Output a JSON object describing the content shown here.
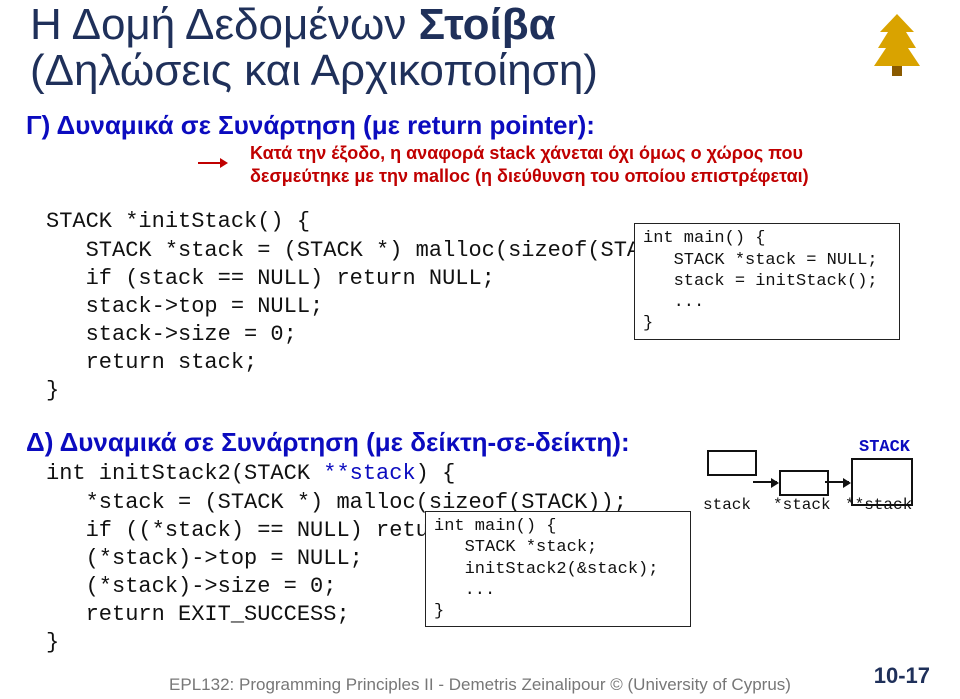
{
  "title": {
    "line1_a": "Η Δομή Δεδομένων ",
    "line1_b": "Στοίβα",
    "line2": "(Δηλώσεις και Αρχικοποίηση)"
  },
  "sectionC": {
    "heading": "Γ) Δυναμικά σε Συνάρτηση (με return pointer):",
    "note1": "Κατά την έξοδο, η αναφορά stack χάνεται όχι όμως ο χώρος που",
    "note2": "δεσμεύτηκε με την malloc (η διεύθυνση του οποίου επιστρέφεται)",
    "code": "STACK *initStack() {\n   STACK *stack = (STACK *) malloc(sizeof(STACK));\n   if (stack == NULL) return NULL;\n   stack->top = NULL;\n   stack->size = 0;\n   return stack;\n}",
    "usage": "int main() {\n   STACK *stack = NULL;\n   stack = initStack();\n   ...\n}"
  },
  "sectionD": {
    "heading": "Δ) Δυναμικά σε Συνάρτηση (με δείκτη-σε-δείκτη):",
    "code_l1": "int initStack2(STACK ",
    "code_l1b": "**stack",
    "code_l1c": ") {",
    "code_l2": "   *stack = (STACK *) malloc(sizeof(STACK));",
    "code_l3": "   if ((*stack) == NULL) return EXIT_FAILURE;",
    "code_l4": "   (*stack)->top = NULL;",
    "code_l5": "   (*stack)->size = 0;",
    "code_l6": "   return EXIT_SUCCESS;",
    "code_l7": "}",
    "usage": "int main() {\n   STACK *stack;\n   initStack2(&stack);\n   ...\n}",
    "diag": {
      "big": "STACK",
      "star": "*stack",
      "dblstar": "**stack",
      "small": "stack"
    }
  },
  "footer": "EPL132: Programming Principles II - Demetris Zeinalipour © (University of Cyprus)",
  "page": "10-17"
}
